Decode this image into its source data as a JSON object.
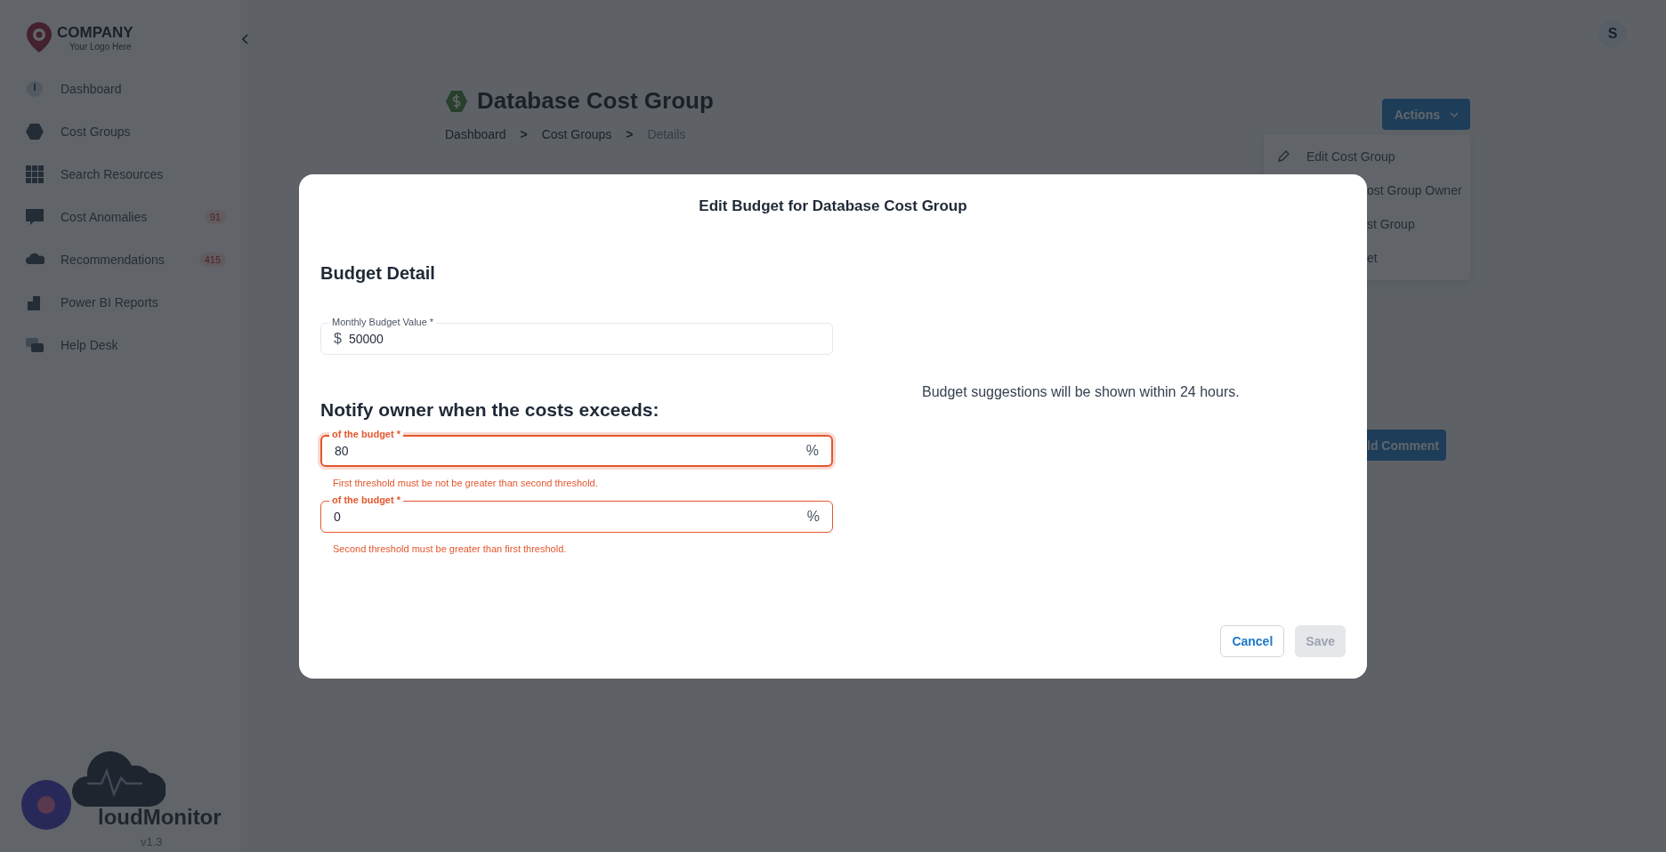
{
  "sidebar": {
    "logo": {
      "name": "COMPANY",
      "tagline": "Your Logo Here"
    },
    "items": [
      {
        "label": "Dashboard"
      },
      {
        "label": "Cost Groups"
      },
      {
        "label": "Search Resources"
      },
      {
        "label": "Cost Anomalies",
        "badge": "91"
      },
      {
        "label": "Recommendations",
        "badge": "415"
      },
      {
        "label": "Power BI Reports"
      },
      {
        "label": "Help Desk"
      }
    ],
    "product": {
      "name": "loudMonitor",
      "version": "v1.3"
    }
  },
  "user": {
    "initial": "S"
  },
  "page": {
    "title": "Database Cost Group",
    "breadcrumb": [
      {
        "label": "Dashboard",
        "selected": false
      },
      {
        "label": "Cost Groups",
        "selected": false
      },
      {
        "label": "Details",
        "selected": true
      }
    ],
    "separator": ">",
    "actions": {
      "label": "Actions",
      "items": [
        {
          "kind": "full",
          "label": "Edit Cost Group"
        },
        {
          "kind": "partial",
          "label": "ost Group Owner"
        },
        {
          "kind": "partial",
          "label": "st Group"
        },
        {
          "kind": "partial",
          "label": "et"
        }
      ]
    },
    "comment_button": "ld Comment"
  },
  "modal": {
    "title": "Edit Budget for Database Cost Group",
    "section": "Budget Detail",
    "budget_field": {
      "label": "Monthly Budget Value *",
      "prefix": "$",
      "value": "50000"
    },
    "notify_heading": "Notify owner when the costs exceeds:",
    "thresholds": [
      {
        "label": "of the budget *",
        "value": "80",
        "suffix": "%",
        "error": true,
        "focused": true,
        "message": "First threshold must be not be greater than second threshold."
      },
      {
        "label": "of the budget *",
        "value": "0",
        "suffix": "%",
        "error": true,
        "focused": false,
        "message": "Second threshold must be greater than first threshold."
      }
    ],
    "suggestion": "Budget suggestions will be shown within 24 hours.",
    "buttons": [
      {
        "kind": "cancel",
        "label": "Cancel",
        "disabled": false
      },
      {
        "kind": "save",
        "label": "Save",
        "disabled": true
      }
    ]
  }
}
